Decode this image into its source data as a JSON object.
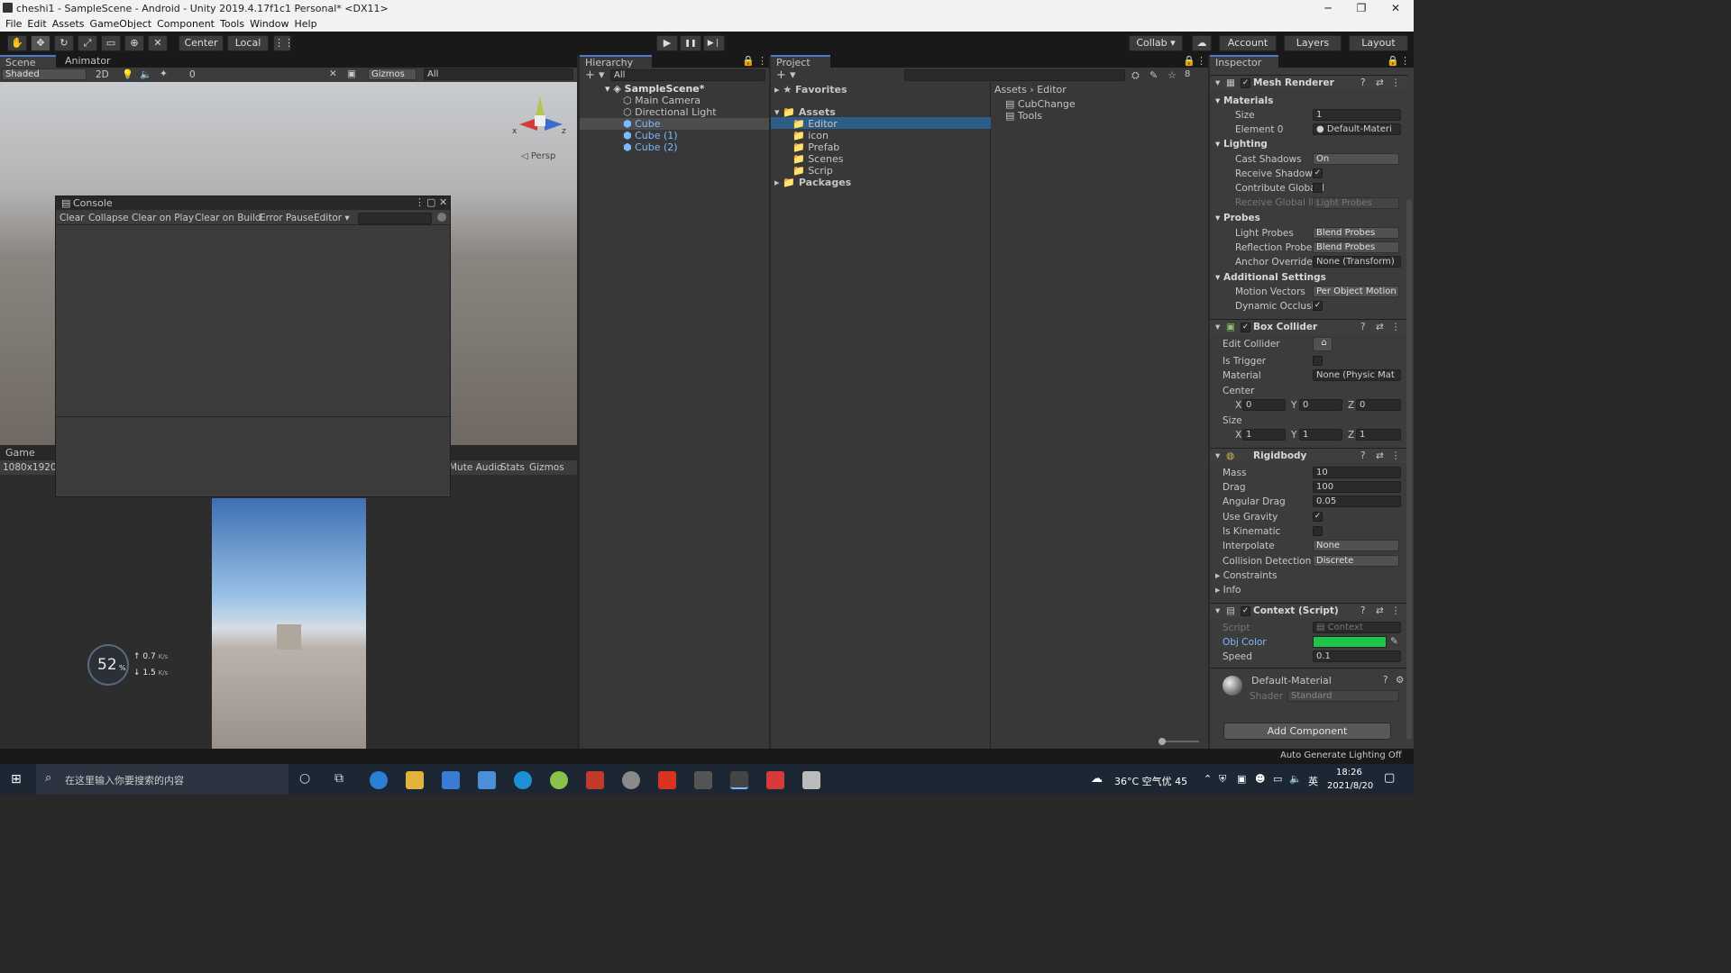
{
  "window": {
    "title": "cheshi1 - SampleScene - Android - Unity 2019.4.17f1c1 Personal* <DX11>",
    "min": "─",
    "max": "❐",
    "close": "✕"
  },
  "menu": [
    "File",
    "Edit",
    "Assets",
    "GameObject",
    "Component",
    "Tools",
    "Window",
    "Help"
  ],
  "toolbar": {
    "pivot": "Center",
    "space": "Local",
    "collab": "Collab ▾",
    "account": "Account",
    "layers": "Layers",
    "layout": "Layout",
    "play": "▶",
    "pause": "❚❚",
    "step": "▶❘"
  },
  "scene": {
    "tab_scene": "Scene",
    "tab_animator": "Animator",
    "shading": "Shaded",
    "mode2d": "2D",
    "hidden_count": "0",
    "gizmos": "Gizmos",
    "search_placeholder": "All",
    "persp": "◁ Persp",
    "axis_x": "x",
    "axis_z": "z"
  },
  "console": {
    "title": "Console",
    "buttons": [
      "Clear",
      "Collapse",
      "Clear on Play",
      "Clear on Build",
      "Error Pause",
      "Editor ▾"
    ]
  },
  "game": {
    "tab": "Game",
    "resolution": "1080x1920",
    "mute": "Mute Audio",
    "stats": "Stats",
    "gizmos": "Gizmos",
    "perf": "52",
    "perf_unit": "%",
    "up": "0.7",
    "down": "1.5",
    "rate_unit": "K/s"
  },
  "hierarchy": {
    "title": "Hierarchy",
    "search": "All",
    "scene": "SampleScene*",
    "items": [
      "Main Camera",
      "Directional Light",
      "Cube",
      "Cube (1)",
      "Cube (2)"
    ]
  },
  "project": {
    "title": "Project",
    "favorites": "Favorites",
    "assets": "Assets",
    "folders": [
      "Editor",
      "icon",
      "Prefab",
      "Scenes",
      "Scrip"
    ],
    "packages": "Packages",
    "breadcrumb_root": "Assets",
    "breadcrumb_sep": "›",
    "breadcrumb_leaf": "Editor",
    "files": [
      "CubChange",
      "Tools"
    ],
    "hidden_count": "8"
  },
  "inspector": {
    "title": "Inspector",
    "mesh_renderer": {
      "name": "Mesh Renderer",
      "materials": "Materials",
      "size_label": "Size",
      "size": "1",
      "element0_label": "Element 0",
      "element0": "Default-Materi",
      "lighting": "Lighting",
      "cast_label": "Cast Shadows",
      "cast": "On",
      "receive_label": "Receive Shadows",
      "contribute_label": "Contribute Global I",
      "receive_gi_label": "Receive Global Illu",
      "receive_gi": "Light Probes",
      "probes": "Probes",
      "light_probes_label": "Light Probes",
      "light_probes": "Blend Probes",
      "refl_label": "Reflection Probes",
      "refl": "Blend Probes",
      "anchor_label": "Anchor Override",
      "anchor": "None (Transform)",
      "additional": "Additional Settings",
      "motion_label": "Motion Vectors",
      "motion": "Per Object Motion",
      "dynocc_label": "Dynamic Occlusio"
    },
    "box_collider": {
      "name": "Box Collider",
      "edit_label": "Edit Collider",
      "trigger_label": "Is Trigger",
      "material_label": "Material",
      "material": "None (Physic Mat",
      "center_label": "Center",
      "size_label": "Size",
      "cx": "0",
      "cy": "0",
      "cz": "0",
      "sx": "1",
      "sy": "1",
      "sz": "1",
      "x": "X",
      "y": "Y",
      "z": "Z"
    },
    "rigidbody": {
      "name": "Rigidbody",
      "mass_label": "Mass",
      "mass": "10",
      "drag_label": "Drag",
      "drag": "100",
      "adrag_label": "Angular Drag",
      "adrag": "0.05",
      "gravity_label": "Use Gravity",
      "kinematic_label": "Is Kinematic",
      "interp_label": "Interpolate",
      "interp": "None",
      "coll_label": "Collision Detection",
      "coll": "Discrete",
      "constraints": "Constraints",
      "info": "Info"
    },
    "context": {
      "name": "Context (Script)",
      "script_label": "Script",
      "script": "Context",
      "color_label": "Obj Color",
      "speed_label": "Speed",
      "speed": "0.1",
      "color": "#1fc44a"
    },
    "material": {
      "name": "Default-Material",
      "shader_label": "Shader",
      "shader": "Standard"
    },
    "add_component": "Add Component",
    "status": "Auto Generate Lighting Off"
  },
  "taskbar": {
    "search": "在这里输入你要搜索的内容",
    "weather": "36°C 空气优 45",
    "ime": "英",
    "time": "18:26",
    "date": "2021/8/20"
  }
}
